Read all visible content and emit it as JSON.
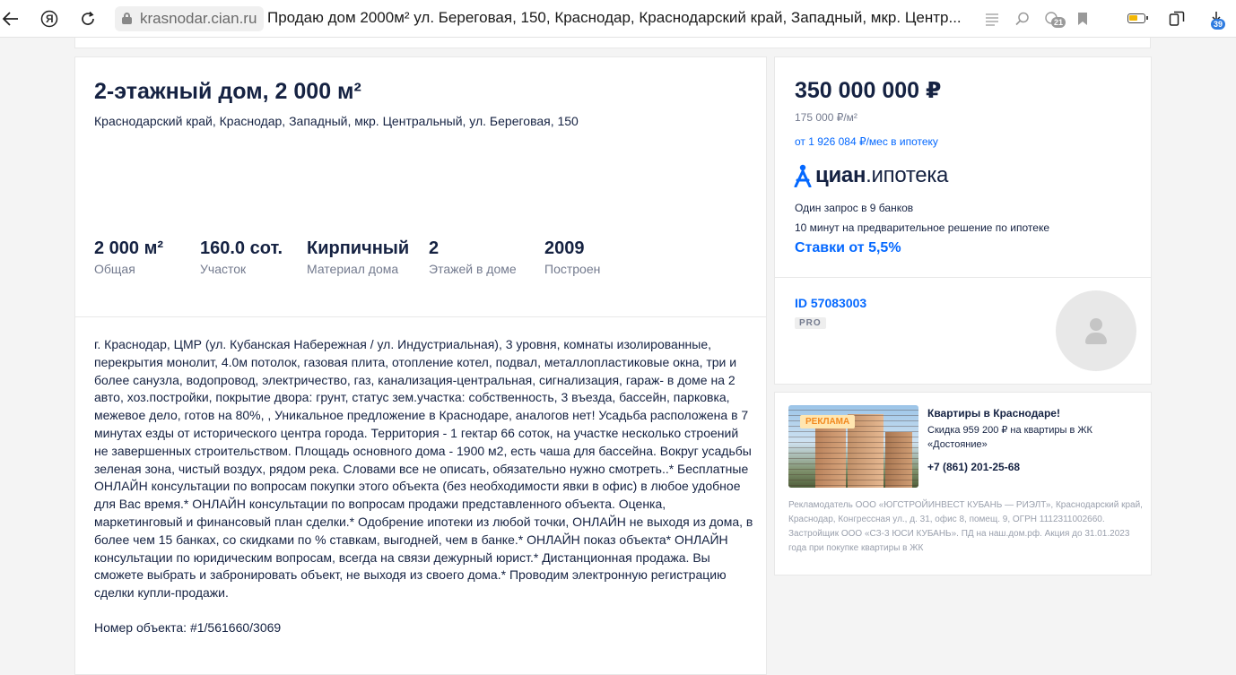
{
  "browser": {
    "url": "krasnodar.cian.ru",
    "title": "Продаю дом 2000м² ул. Береговая, 150, Краснодар, Краснодарский край, Западный, мкр. Центр...",
    "yandex_glyph": "Я",
    "tabs_badge": "21",
    "downloads_badge": "39"
  },
  "listing": {
    "title": "2-этажный дом, 2 000 м²",
    "address": "Краснодарский край, Краснодар, Западный, мкр. Центральный, ул. Береговая, 150",
    "facts": [
      {
        "value": "2 000 м²",
        "label": "Общая"
      },
      {
        "value": "160.0 сот.",
        "label": "Участок"
      },
      {
        "value": "Кирпичный",
        "label": "Материал дома"
      },
      {
        "value": "2",
        "label": "Этажей в доме"
      },
      {
        "value": "2009",
        "label": "Построен"
      }
    ],
    "description": "г. Краснодар, ЦМР (ул. Кубанская Набережная / ул. Индустриальная), 3 уровня, комнаты изолированные, перекрытия монолит, 4.0м потолок, газовая плита, отопление котел, подвал, металлопластиковые окна, три и более санузла, водопровод, электричество, газ, канализация-центральная, сигнализация, гараж- в доме на 2 авто, хоз.постройки, покрытие двора: грунт, статус зем.участка: собственность, 3 въезда, бассейн, парковка, межевое дело, готов на 80%, , Уникальное предложение в Краснодаре, аналогов нет! Усадьба расположена в 7 минутах езды от исторического центра города. Территория - 1 гектар 66 соток, на участке несколько строений не завершенных строительством. Площадь основного дома - 1900 м2, есть чаша для бассейна. Вокруг усадьбы зеленая зона, чистый воздух, рядом река. Словами все не описать, обязательно нужно смотреть..* Бесплатные ОНЛАЙН консультации по вопросам покупки этого объекта (без необходимости явки в офис) в любое удобное для Вас время.* ОНЛАЙН консультации по вопросам продажи представленного объекта. Оценка, маркетинговый и финансовый план сделки.* Одобрение ипотеки из любой точки, ОНЛАЙН  не выходя из дома, в более чем 15 банках, со скидками по % ставкам, выгодней, чем в банке.* ОНЛАЙН показ объекта* ОНЛАЙН консультации по юридическим вопросам, всегда на связи дежурный юрист.* Дистанционная продажа. Вы сможете выбрать и забронировать объект, не выходя из своего дома.* Проводим электронную регистрацию сделки купли-продажи.",
    "object_number": "Номер объекта: #1/561660/3069"
  },
  "price": {
    "total": "350 000 000 ₽",
    "per_m2": "175 000 ₽/м²",
    "mortgage_link": "от 1 926 084 ₽/мес в ипотеку"
  },
  "mortgage": {
    "logo_bold": "циан",
    "logo_rest": ".ипотека",
    "line1": "Один запрос в 9 банков",
    "line2": "10 минут на предварительное решение по ипотеке",
    "rates": "Ставки от 5,5%"
  },
  "agent": {
    "id": "ID 57083003",
    "badge": "PRO"
  },
  "ad": {
    "tag": "РЕКЛАМА",
    "title": "Квартиры в Краснодаре!",
    "text": "Скидка 959 200 ₽ на квартиры в ЖК «Достояние»",
    "phone": "+7 (861) 201-25-68",
    "legal": "Рекламодатель ООО «ЮГСТРОЙИНВЕСТ КУБАНЬ — РИЭЛТ», Краснодарский край, Краснодар, Конгрессная ул., д. 31, офис 8, помещ. 9, ОГРН 1112311002660. Застройщик ООО «СЗ-3 ЮСИ КУБАНЬ». ПД на наш.дом.рф. Акция до 31.01.2023 года при покупке квартиры в ЖК"
  },
  "colors": {
    "text": "#152242",
    "accent": "#0468ff",
    "muted": "#737a8e",
    "background": "#f4f4f4"
  }
}
